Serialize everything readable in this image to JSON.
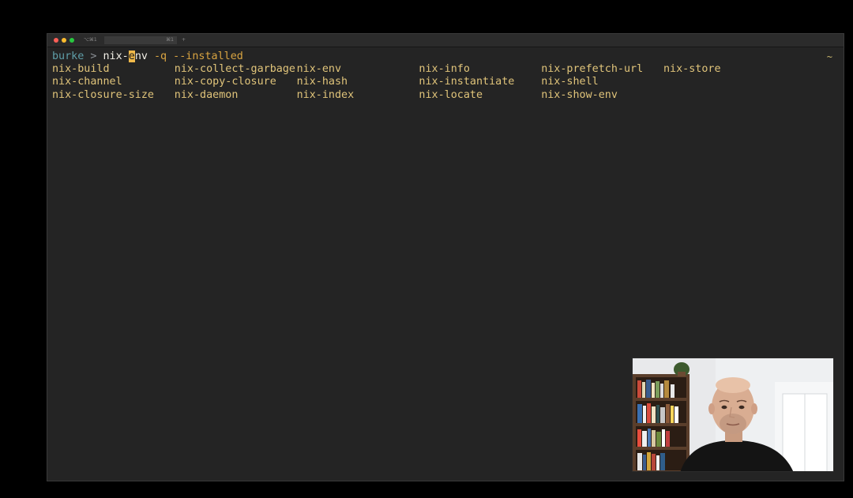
{
  "titlebar": {
    "tabs": [
      "⌥⌘1",
      "⌘1",
      "+"
    ]
  },
  "terminal": {
    "prompt": {
      "user": "burke",
      "arrow": " > ",
      "cmd_before_cursor": "nix-",
      "cursor_char": "e",
      "cmd_after_cursor": "nv",
      "args": " -q --installed"
    },
    "right_indicator": "~",
    "completions": [
      "nix-build",
      "nix-collect-garbage",
      "nix-env",
      "nix-info",
      "nix-prefetch-url",
      "nix-store",
      "nix-channel",
      "nix-copy-closure",
      "nix-hash",
      "nix-instantiate",
      "nix-shell",
      "",
      "nix-closure-size",
      "nix-daemon",
      "nix-index",
      "nix-locate",
      "nix-show-env",
      ""
    ]
  },
  "colors": {
    "terminal_bg": "#242424",
    "completion_text": "#e0c47a",
    "prompt_user": "#5f9ea8",
    "cursor": "#f0b94a"
  }
}
